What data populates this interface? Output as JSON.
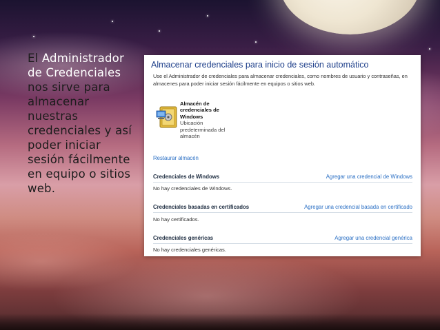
{
  "slide": {
    "narration_plain_1": "El ",
    "narration_highlight": "Administrador de Credenciales",
    "narration_plain_2": " nos sirve para almacenar nuestras credenciales y así poder iniciar sesión fácilmente en equipo o sitios web."
  },
  "window": {
    "title": "Almacenar credenciales para inicio de sesión automático",
    "description": "Use el Administrador de credenciales para almacenar credenciales, como nombres de usuario y contraseñas, en almacenes para poder iniciar sesión fácilmente en equipos o sitios web.",
    "vault": {
      "title": "Almacén de credenciales de Windows",
      "subtitle": "Ubicación predeterminada del almacén",
      "icon": "vault-icon"
    },
    "restore_link": "Restaurar almacén",
    "sections": [
      {
        "title": "Credenciales de Windows",
        "link": "Agregar una credencial de Windows",
        "empty": "No hay credenciales de Windows."
      },
      {
        "title": "Credenciales basadas en certificados",
        "link": "Agregar una credencial basada en certificado",
        "empty": "No hay certificados."
      },
      {
        "title": "Credenciales genéricas",
        "link": "Agregar una credencial genérica",
        "empty": "No hay credenciales genéricas."
      }
    ]
  },
  "colors": {
    "link": "#2a6fc4",
    "window_title": "#1e3f8a",
    "highlight_text": "#ffffff"
  }
}
